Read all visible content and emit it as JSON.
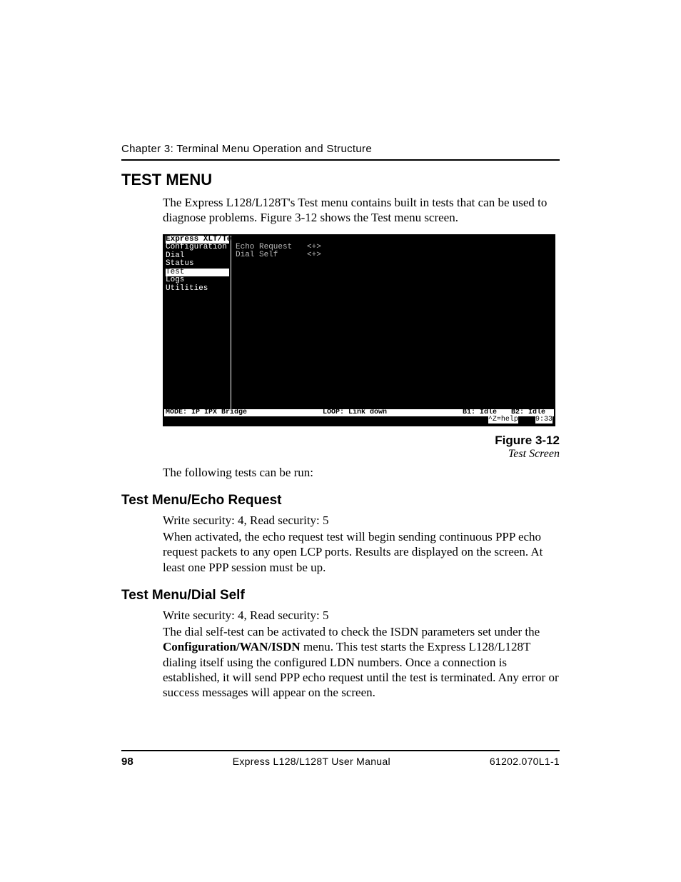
{
  "header": {
    "chapter": "Chapter 3: Terminal Menu Operation and Structure"
  },
  "section": {
    "title": "TEST MENU",
    "intro": "The Express L128/L128T's Test menu contains built in tests that can be used to diagnose problems.  Figure 3-12 shows the Test menu screen."
  },
  "terminal": {
    "path": "Express XLT/Test",
    "sidebar": [
      "Configuration",
      "Dial",
      "Status",
      "Test",
      "Logs",
      "Utilities"
    ],
    "content": [
      {
        "label": "Echo Request",
        "action": "<+>"
      },
      {
        "label": "Dial Self",
        "action": "<+>"
      }
    ],
    "status": {
      "mode": "MODE: IP IPX Bridge",
      "loop": "LOOP: Link down",
      "b1": "B1: Idle",
      "b2": "B2: Idle"
    },
    "help": {
      "key": "^Z=help",
      "time": "9:33"
    }
  },
  "figure": {
    "number": "Figure 3-12",
    "title": "Test Screen"
  },
  "followup": "The following tests can be run:",
  "echo": {
    "heading": "Test Menu/Echo Request",
    "sec": "Write security: 4, Read security: 5",
    "body": "When activated, the echo request test will begin sending continuous PPP echo request packets to any open LCP ports.  Results are displayed on the screen.  At least one PPP session must be up."
  },
  "dialself": {
    "heading": "Test Menu/Dial Self",
    "sec": "Write security: 4, Read security: 5",
    "body_pre": "The dial self-test can be activated to check the ISDN parameters set under the ",
    "bold": "Configuration/WAN/ISDN",
    "body_post": " menu.  This test starts the Express L128/L128T dialing itself using the configured LDN numbers.  Once a connection is established, it will send PPP echo request until the test is terminated.  Any error or success messages will appear on the screen."
  },
  "footer": {
    "page": "98",
    "manual": "Express L128/L128T User Manual",
    "docid": "61202.070L1-1"
  }
}
